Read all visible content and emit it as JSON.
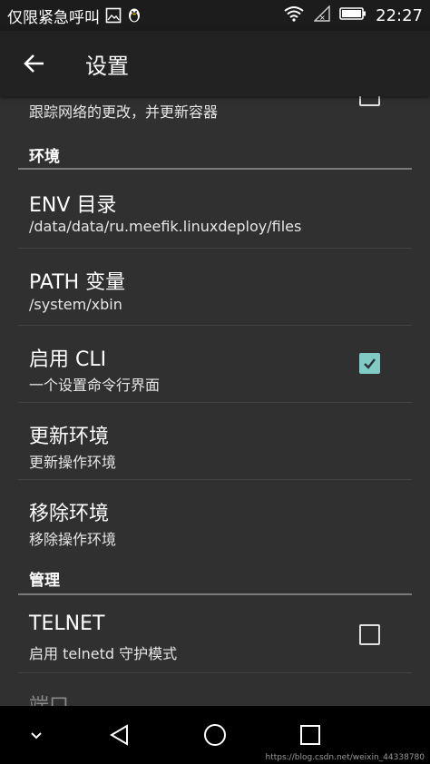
{
  "status_bar": {
    "carrier_text": "仅限紧急呼叫",
    "time": "22:27",
    "icons": [
      "image-icon",
      "qq-penguin-icon",
      "wifi-icon",
      "signal-no-sim-icon",
      "battery-icon"
    ]
  },
  "app_bar": {
    "title": "设置",
    "back_icon": "arrow-back-icon"
  },
  "partial_item": {
    "summary": "跟踪网络的更改，并更新容器"
  },
  "categories": {
    "environment": "环境",
    "management": "管理"
  },
  "items": [
    {
      "title": "ENV 目录",
      "summary": "/data/data/ru.meefik.linuxdeploy/files"
    },
    {
      "title": "PATH 变量",
      "summary": "/system/xbin"
    },
    {
      "title": "启用 CLI",
      "summary": "一个设置命令行界面",
      "checked": true
    },
    {
      "title": "更新环境",
      "summary": "更新操作环境"
    },
    {
      "title": "移除环境",
      "summary": "移除操作环境"
    }
  ],
  "management_items": [
    {
      "title": "TELNET",
      "summary": "启用 telnetd 守护模式",
      "checked": false
    },
    {
      "title": "端口"
    }
  ],
  "nav_bar": {
    "buttons": [
      "hide-keyboard-icon",
      "back-triangle-icon",
      "home-circle-icon",
      "recents-square-icon"
    ]
  },
  "watermark": "https://blog.csdn.net/weixin_44338780",
  "colors": {
    "background": "#303030",
    "app_bar": "#222222",
    "status_bar": "#1c1c1c",
    "accent": "#80cbc4",
    "divider": "#424242"
  }
}
